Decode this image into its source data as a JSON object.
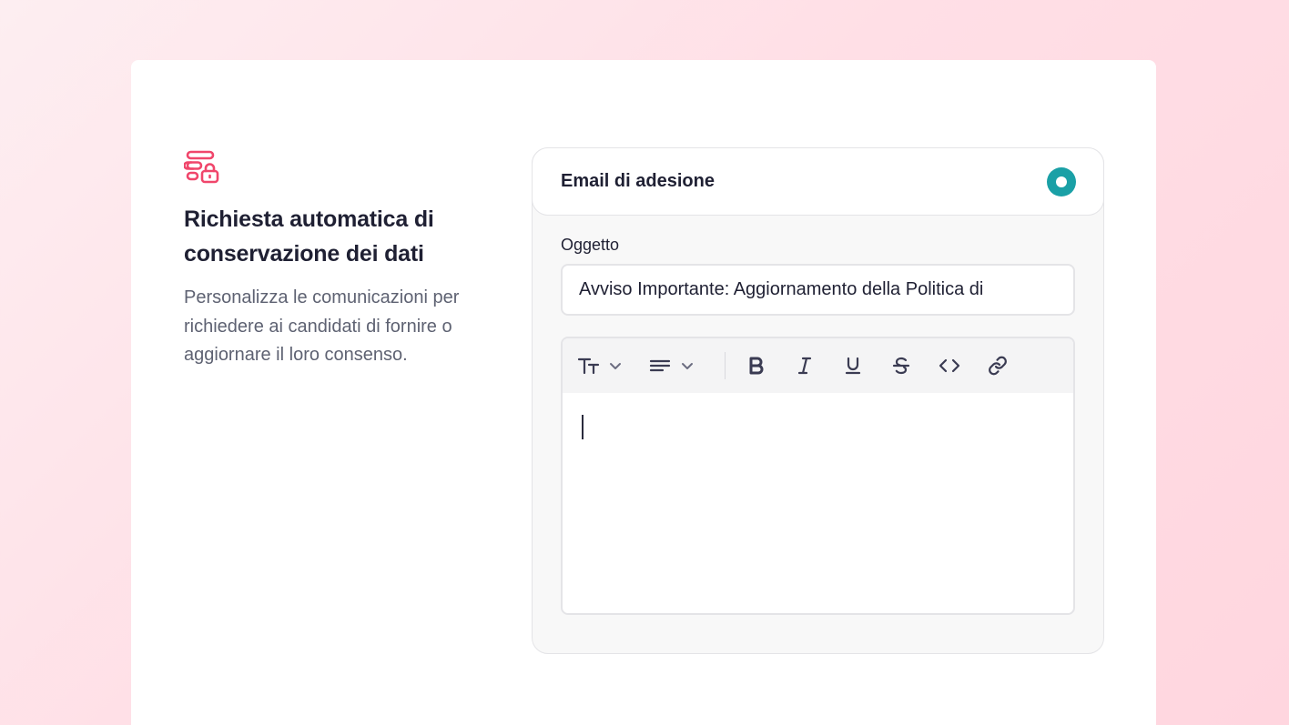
{
  "feature": {
    "icon": "form-lock-icon",
    "title_line1": "Richiesta automatica di",
    "title_line2": "conservazione dei dati",
    "description": "Personalizza le comunicazioni per richiedere ai candidati di fornire o aggiornare il loro consenso."
  },
  "panel": {
    "title": "Email di adesione",
    "subject_label": "Oggetto",
    "subject_value": "Avviso Importante: Aggiornamento della Politica di",
    "toolbar": [
      "text-size-icon",
      "chevron-down-icon",
      "align-icon",
      "chevron-down-icon",
      "bold-icon",
      "italic-icon",
      "underline-icon",
      "strikethrough-icon",
      "code-icon",
      "link-icon"
    ],
    "body_text": ""
  },
  "colors": {
    "accent_pink": "#f0466b",
    "radio_teal": "#1aa0a6",
    "text_dark": "#1f2033",
    "text_muted": "#5e6272"
  }
}
